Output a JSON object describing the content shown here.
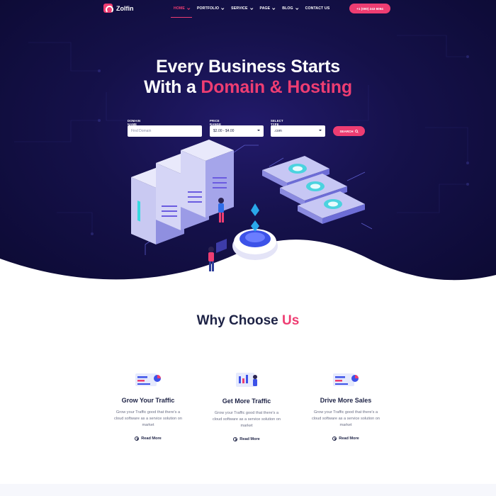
{
  "brand": {
    "name": "Zolfin",
    "accent": "#ee3d72",
    "dark": "#15114a"
  },
  "nav": {
    "items": [
      {
        "label": "HOME",
        "dropdown": true,
        "active": true
      },
      {
        "label": "PORTFOLIO",
        "dropdown": true
      },
      {
        "label": "SERVICE",
        "dropdown": true
      },
      {
        "label": "PAGE",
        "dropdown": true
      },
      {
        "label": "BLOG",
        "dropdown": true
      },
      {
        "label": "CONTACT US",
        "dropdown": false
      }
    ],
    "phone": "+1 (000) 243 6094"
  },
  "hero": {
    "line1": "Every Business Starts",
    "line2_prefix": "With a ",
    "line2_accent": "Domain & Hosting"
  },
  "search": {
    "domain": {
      "label": "DOMAIN NAME",
      "placeholder": "Find Domain"
    },
    "price": {
      "label": "PRICE RANGE",
      "value": "$2.00 - $4.00"
    },
    "type": {
      "label": "SELECT TYPE",
      "value": ".com"
    },
    "button_label": "SEARCH",
    "button_icon": "search-icon"
  },
  "why": {
    "title_prefix": "Why Choose ",
    "title_accent": "Us",
    "features": [
      {
        "title": "Grow Your Traffic",
        "text": "Grow your Traffic good that there's a cloud software as a service solution on market",
        "link": "Read More",
        "icon": "traffic-chart-icon"
      },
      {
        "title": "Get More Traffic",
        "text": "Grow your Traffic good that there's a cloud software as a service solution on market",
        "link": "Read More",
        "icon": "analytics-person-icon"
      },
      {
        "title": "Drive More Sales",
        "text": "Grow your Traffic good that there's a cloud software as a service solution on market",
        "link": "Read More",
        "icon": "sales-chart-icon"
      }
    ]
  }
}
